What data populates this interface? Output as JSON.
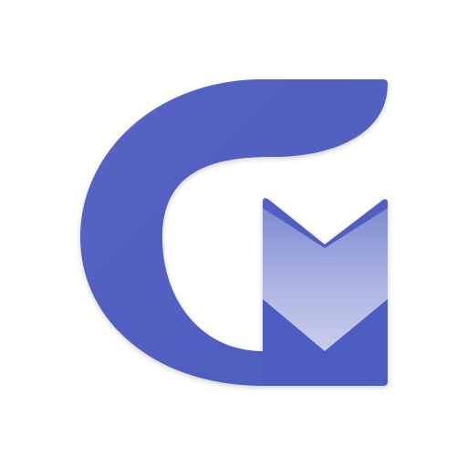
{
  "logo": {
    "icon": "g-arrow-logo-icon",
    "colors": {
      "background": "#ffffff",
      "primary": "#5664c3",
      "primary_dark": "#4d5cbf",
      "arrow_light": "#c7cdec",
      "arrow_fade_top": "#7f8ad0"
    }
  }
}
